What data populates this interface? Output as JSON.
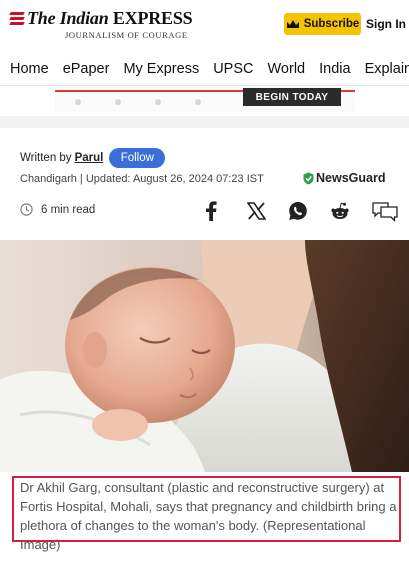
{
  "header": {
    "logo_prefix": "The Indian",
    "logo_main": "EXPRESS",
    "tagline": "JOURNALISM OF COURAGE",
    "subscribe_label": "Subscribe",
    "signin_label": "Sign In",
    "brand_red": "#c8102e",
    "subscribe_color": "#f5c400"
  },
  "nav": {
    "items": [
      {
        "label": "Home"
      },
      {
        "label": "ePaper"
      },
      {
        "label": "My Express"
      },
      {
        "label": "UPSC"
      },
      {
        "label": "World"
      },
      {
        "label": "India"
      },
      {
        "label": "Explained"
      }
    ]
  },
  "ad": {
    "cta": "BEGIN TODAY"
  },
  "article": {
    "written_by": "Written by",
    "author": "Parul",
    "follow_label": "Follow",
    "dateline": "Chandigarh | Updated: August 26, 2024 07:23 IST",
    "newsguard": "NewsGuard",
    "read_time": "6 min read",
    "share_icons": [
      "facebook-icon",
      "x-icon",
      "whatsapp-icon",
      "reddit-icon",
      "comment-icon"
    ],
    "hero_alt": "Newborn baby resting on mother's shoulder",
    "caption": "Dr Akhil Garg, consultant (plastic and reconstructive surgery) at Fortis Hospital, Mohali, says that pregnancy and childbirth bring a plethora of changes to the woman's body. (Representational Image)"
  }
}
